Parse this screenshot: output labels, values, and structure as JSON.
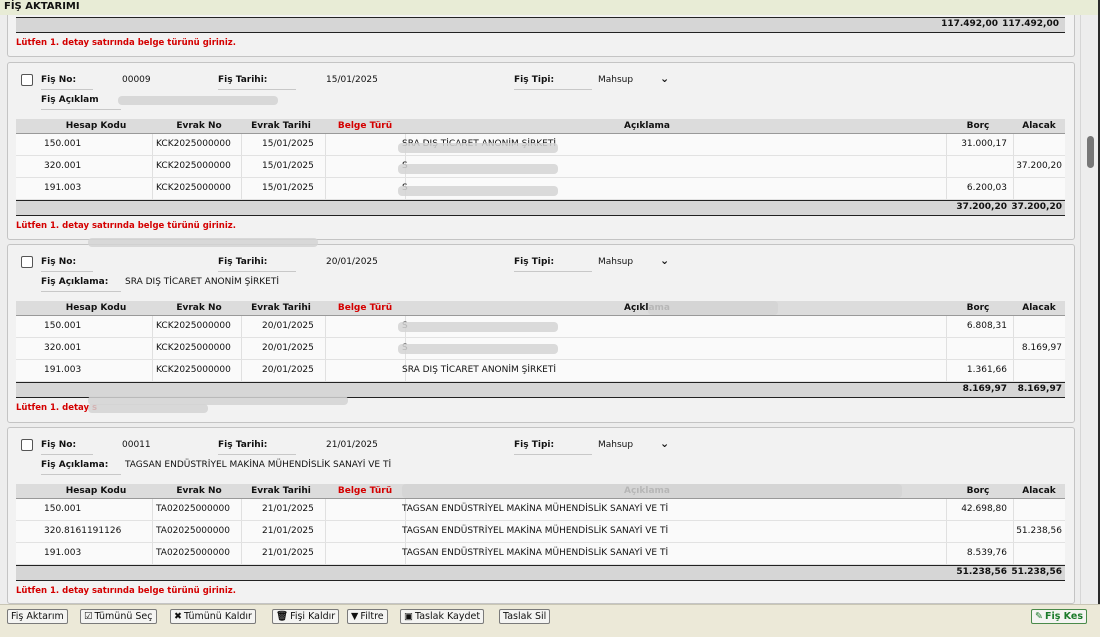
{
  "window": {
    "title": "FİŞ AKTARIMI"
  },
  "top_card": {
    "borc_total": "117.492,00",
    "alacak_total": "117.492,00",
    "error": "Lütfen 1. detay satırında belge türünü giriniz."
  },
  "labels": {
    "fis_no": "Fiş No:",
    "fis_tarihi": "Fiş Tarihi:",
    "fis_tipi": "Fiş Tipi:",
    "fis_aciklama": "Fiş Açıklama:",
    "fis_aciklama_partial": "Fiş Açıklam"
  },
  "columns": [
    "Hesap Kodu",
    "Evrak No",
    "Evrak Tarihi",
    "Belge Türü",
    "Açıklama",
    "Borç",
    "Alacak"
  ],
  "cards": [
    {
      "fis_no": "00009",
      "fis_tarihi": "15/01/2025",
      "fis_tipi": "Mahsup",
      "fis_aciklama": "",
      "rows": [
        {
          "hesap": "150.001",
          "evrak_no": "KCK2025000000",
          "tarih": "15/01/2025",
          "aciklama": "SRA DIŞ TİCARET ANONİM ŞİRKETİ",
          "borc": "31.000,17",
          "alacak": ""
        },
        {
          "hesap": "320.001",
          "evrak_no": "KCK2025000000",
          "tarih": "15/01/2025",
          "aciklama": "S",
          "borc": "",
          "alacak": "37.200,20"
        },
        {
          "hesap": "191.003",
          "evrak_no": "KCK2025000000",
          "tarih": "15/01/2025",
          "aciklama": "S",
          "borc": "6.200,03",
          "alacak": ""
        }
      ],
      "borc_total": "37.200,20",
      "alacak_total": "37.200,20",
      "error": "Lütfen 1. detay satırında belge türünü giriniz."
    },
    {
      "fis_no": "",
      "fis_tarihi": "20/01/2025",
      "fis_tipi": "Mahsup",
      "fis_aciklama": "SRA DIŞ TİCARET ANONİM ŞİRKETİ",
      "rows": [
        {
          "hesap": "150.001",
          "evrak_no": "KCK2025000000",
          "tarih": "20/01/2025",
          "aciklama": "S",
          "borc": "6.808,31",
          "alacak": ""
        },
        {
          "hesap": "320.001",
          "evrak_no": "KCK2025000000",
          "tarih": "20/01/2025",
          "aciklama": "S",
          "borc": "",
          "alacak": "8.169,97"
        },
        {
          "hesap": "191.003",
          "evrak_no": "KCK2025000000",
          "tarih": "20/01/2025",
          "aciklama": "SRA DIŞ TİCARET ANONİM ŞİRKETİ",
          "borc": "1.361,66",
          "alacak": ""
        }
      ],
      "borc_total": "8.169,97",
      "alacak_total": "8.169,97",
      "error": "Lütfen 1. detay s"
    },
    {
      "fis_no": "00011",
      "fis_tarihi": "21/01/2025",
      "fis_tipi": "Mahsup",
      "fis_aciklama": "TAGSAN ENDÜSTRİYEL MAKİNA MÜHENDİSLİK SANAYİ VE Tİ",
      "rows": [
        {
          "hesap": "150.001",
          "evrak_no": "TA02025000000",
          "tarih": "21/01/2025",
          "aciklama": "TAGSAN ENDÜSTRİYEL MAKİNA MÜHENDİSLİK SANAYİ VE Tİ",
          "borc": "42.698,80",
          "alacak": ""
        },
        {
          "hesap": "320.8161191126",
          "evrak_no": "TA02025000000",
          "tarih": "21/01/2025",
          "aciklama": "TAGSAN ENDÜSTRİYEL MAKİNA MÜHENDİSLİK SANAYİ VE Tİ",
          "borc": "",
          "alacak": "51.238,56"
        },
        {
          "hesap": "191.003",
          "evrak_no": "TA02025000000",
          "tarih": "21/01/2025",
          "aciklama": "TAGSAN ENDÜSTRİYEL MAKİNA MÜHENDİSLİK SANAYİ VE Tİ",
          "borc": "8.539,76",
          "alacak": ""
        }
      ],
      "borc_total": "51.238,56",
      "alacak_total": "51.238,56",
      "error": "Lütfen 1. detay satırında belge türünü giriniz."
    }
  ],
  "toolbar": {
    "fis_aktarim": "Fiş Aktarım",
    "tumunu_sec": "Tümünü Seç",
    "tumunu_kaldir": "Tümünü Kaldır",
    "fisi_kaldir": "Fişi Kaldır",
    "filtre": "Filtre",
    "taslak_kaydet": "Taslak Kaydet",
    "taslak_sil": "Taslak Sil",
    "fis_kes": "Fiş Kes"
  },
  "colors": {
    "error_red": "#d40000",
    "belge_turu_header": "#d40000",
    "fis_kes_green": "#1b7a2a"
  }
}
